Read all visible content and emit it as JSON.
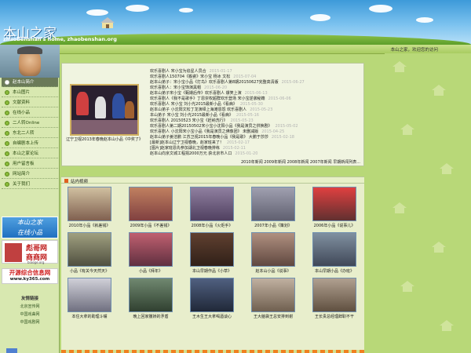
{
  "site": {
    "logo": "本山之家",
    "subtitle": "zhaobenshan's home, zhaobenshan.org",
    "welcome": "本山之家，欢迎您的访问"
  },
  "nav": [
    {
      "label": "赵本山简介",
      "active": true
    },
    {
      "label": "本山图片"
    },
    {
      "label": "文献资料"
    },
    {
      "label": "在线小品"
    },
    {
      "label": "二人转Online"
    },
    {
      "label": "东北二人转"
    },
    {
      "label": "自编剧本上传"
    },
    {
      "label": "本山之家论坛"
    },
    {
      "label": "用户留言板"
    },
    {
      "label": "网站简介"
    },
    {
      "label": "关于我们"
    }
  ],
  "ads": {
    "ad1_line1": "本山之家",
    "ad1_line2": "在线小品",
    "ad2_line1": "彪哥网",
    "ad2_line2": "商商网",
    "ad2_url": "biaoge.org",
    "ad3_line1": "开源综合信息网",
    "ad3_line2": "www.ky365.com"
  },
  "friend_links": {
    "title": "友情链接",
    "items": [
      "北京宣传网",
      "中国戏曲网",
      "中国戏剧网"
    ]
  },
  "feature": {
    "caption": "辽宁卫视2013年春晚赵本山小品《中奖了》"
  },
  "news": [
    {
      "text": "欢乐喜剧人 宋小宝为追星人员合",
      "date": "2015-01-17"
    },
    {
      "text": "欢乐喜剧人150704《搬瓷》宋小宝 杨冰 文松",
      "date": "2015-07-04"
    },
    {
      "text": "赵本山弟子：宋小宝小品《打鸟》欢乐喜剧人第8期20150627完整高清版",
      "date": "2015-06-27"
    },
    {
      "text": "欢乐喜剧人：宋小宝饰演黑帽",
      "date": "2015-06-20"
    },
    {
      "text": "赵本山弟子宋小宝《甄嬛后传》欢乐喜剧人 爆笑上演",
      "date": "2015-06-13"
    },
    {
      "text": "欢乐喜剧人《我不是歌手》丁恩崇权超群欢乐登场 宋小宝逆袭秘籍",
      "date": "2015-06-06"
    },
    {
      "text": "欢乐喜剧人 宋小宝 刘小光2015最新小品《看病》",
      "date": "2015-05-30"
    },
    {
      "text": "赵本山弟子 小沈阳文松丁龙演绎上海滩恩怨 欢乐喜剧人",
      "date": "2015-05-23"
    },
    {
      "text": "本山弟子 宋小宝 刘小光2015最新小品《看病》",
      "date": "2015-05-16"
    },
    {
      "text": "欢乐喜剧人 20150523 宋小宝《赶纳洗行》",
      "date": "2015-05-23"
    },
    {
      "text": "欢乐喜剧人第二期20150502宋小宝小沈阳小品《我是演员之供换剧》",
      "date": "2015-05-02"
    },
    {
      "text": "欢乐喜剧人 小沈阳宋小宝小品《我是演员之佛像团》 未删减版",
      "date": "2015-04-25"
    },
    {
      "text": "赵本山弟子姜洁鹏 江苏卫视2015年春晚小品《我是歌》 大鹏于莎莎",
      "date": "2015-02-18"
    },
    {
      "text": "[最新]赵本山辽宁卫视春晚，赵家班来了！",
      "date": "2015-02-17"
    },
    {
      "text": "[图片]赵家班恩先参加湖北卫视春晚排练",
      "date": "2015-02-11"
    },
    {
      "text": "赵本山向京文城工程捐2000万元 获北京市人口",
      "date": "2015-01-20"
    }
  ],
  "news_more": "2010年新闻 2009年新闻 2008年新闻 2007年新闻 早期新闻列表...",
  "video_section": {
    "title": "站内视频",
    "tiles": [
      {
        "caption": "2010年小品《就差钱》"
      },
      {
        "caption": "2009年小品《不差钱》"
      },
      {
        "caption": "2008年小品《火炬手》"
      },
      {
        "caption": "2007年小品《策划》"
      },
      {
        "caption": "2006年小品《说事儿》"
      },
      {
        "caption": "小品《有关今天然天》"
      },
      {
        "caption": "小品《拜年》"
      },
      {
        "caption": "本山早期作品《小草》"
      },
      {
        "caption": "赵本山小品《说事》"
      },
      {
        "caption": "本山早期小品《办班》"
      },
      {
        "caption": "本住大拿的助理斗嘴"
      },
      {
        "caption": "晚上回家撒娇的矛盾"
      },
      {
        "caption": "王木生王大拿喝酒谈心"
      },
      {
        "caption": "王大脑袋王总安排到谢"
      },
      {
        "caption": "王长贵总经理辞职不干"
      }
    ]
  },
  "colors": {
    "header_top": "#3d9ad9",
    "background": "#b8d878",
    "sidebar": "#d8e8b0",
    "nav_active": "#6a7a58",
    "accent": "#e06020"
  }
}
